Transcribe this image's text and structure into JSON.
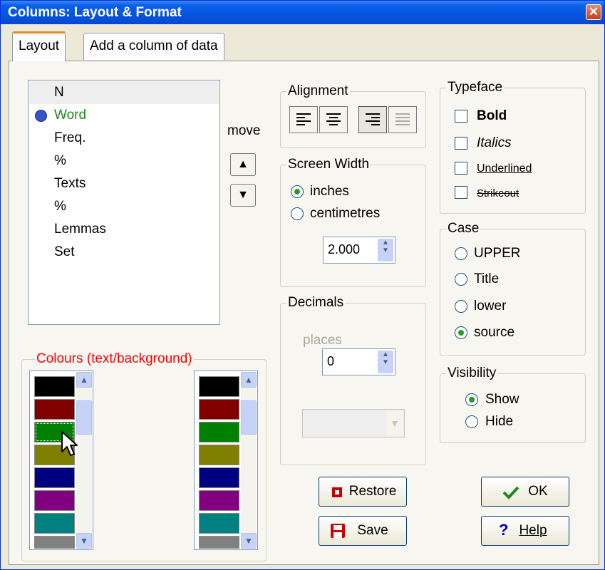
{
  "window": {
    "title": "Columns: Layout & Format",
    "close_glyph": "✕"
  },
  "tabs": [
    {
      "label": "Layout",
      "active": true
    },
    {
      "label": "Add a column of data",
      "active": false
    }
  ],
  "columns_list": {
    "items": [
      "N",
      "Word",
      "Freq.",
      "%",
      "Texts",
      "%",
      "Lemmas",
      "Set"
    ],
    "selected_index": 0,
    "marked_index": 1,
    "marked_color": "#1a8a1a"
  },
  "move": {
    "label": "move",
    "up_glyph": "▲",
    "down_glyph": "▼"
  },
  "alignment": {
    "title": "Alignment",
    "icons": [
      "align-left-icon",
      "align-center-icon",
      "align-right-icon",
      "align-justify-icon"
    ]
  },
  "screen_width": {
    "title": "Screen Width",
    "options": [
      "inches",
      "centimetres"
    ],
    "selected": "inches",
    "value": "2.000"
  },
  "decimals": {
    "title": "Decimals",
    "places_label": "places",
    "value": "0"
  },
  "typeface": {
    "title": "Typeface",
    "options": [
      "Bold",
      "Italics",
      "Underlined",
      "Strikeout"
    ]
  },
  "case": {
    "title": "Case",
    "options": [
      "UPPER",
      "Title",
      "lower",
      "source"
    ],
    "selected": "source"
  },
  "visibility": {
    "title": "Visibility",
    "options": [
      "Show",
      "Hide"
    ],
    "selected": "Show"
  },
  "colours": {
    "title": "Colours (text/background)",
    "title_color": "#ff0000",
    "swatches": [
      "#000000",
      "#800000",
      "#008000",
      "#808000",
      "#000080",
      "#800080",
      "#008080",
      "#808080"
    ]
  },
  "buttons": {
    "restore": "Restore",
    "save": "Save",
    "ok": "OK",
    "help": "Help",
    "help_glyph": "?"
  }
}
